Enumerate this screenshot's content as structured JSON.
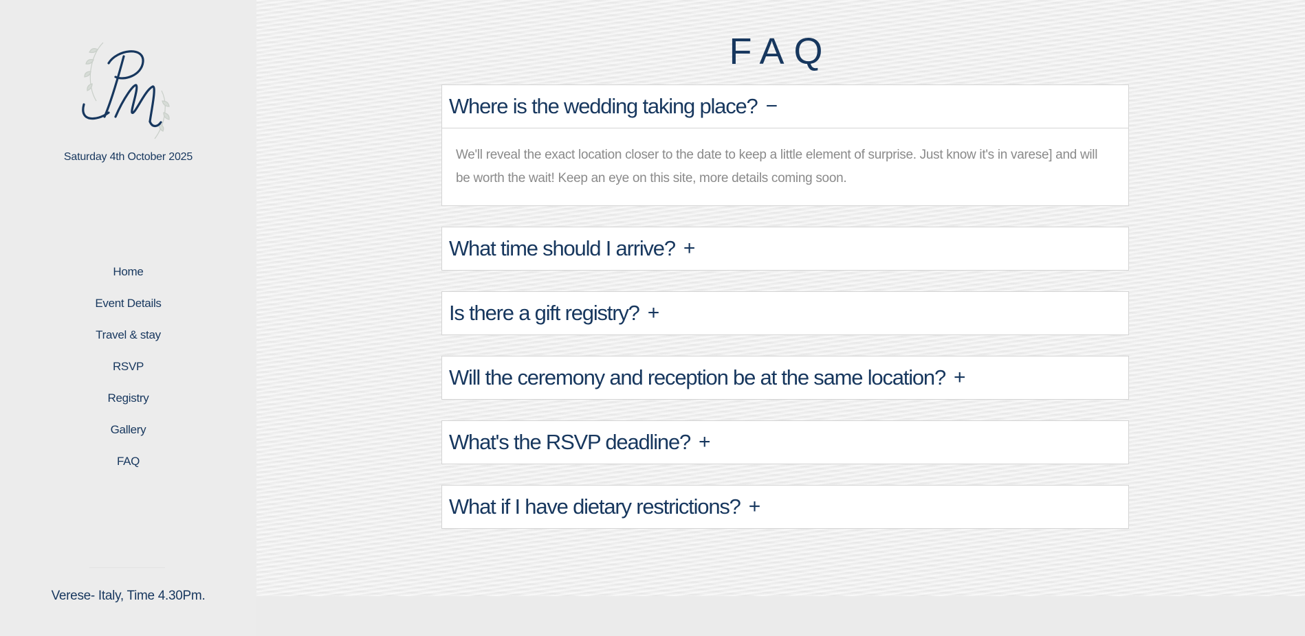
{
  "sidebar": {
    "date": "Saturday 4th October 2025",
    "nav": [
      {
        "label": "Home"
      },
      {
        "label": "Event Details"
      },
      {
        "label": "Travel & stay"
      },
      {
        "label": "RSVP"
      },
      {
        "label": "Registry"
      },
      {
        "label": "Gallery"
      },
      {
        "label": "FAQ"
      }
    ],
    "footer": "Verese- Italy, Time 4.30Pm."
  },
  "main": {
    "title": "FAQ",
    "faq": [
      {
        "question": "Where is the wedding taking place?",
        "toggle": "−",
        "answer": "We'll reveal the exact location closer to the date to keep a little element of surprise. Just know it's in varese] and will be worth the wait! Keep an eye on this site, more details coming soon."
      },
      {
        "question": "What time should I arrive?",
        "toggle": "+"
      },
      {
        "question": "Is there a gift registry?",
        "toggle": "+"
      },
      {
        "question": "Will the ceremony and reception be at the same location?",
        "toggle": "+"
      },
      {
        "question": "What's the RSVP deadline?",
        "toggle": "+"
      },
      {
        "question": "What if I have dietary restrictions?",
        "toggle": "+"
      }
    ]
  },
  "colors": {
    "accent": "#17375e",
    "answer_text": "#8a8a8a",
    "sidebar_bg": "#ececec"
  },
  "icons": {
    "logo": "pm-monogram-logo"
  }
}
